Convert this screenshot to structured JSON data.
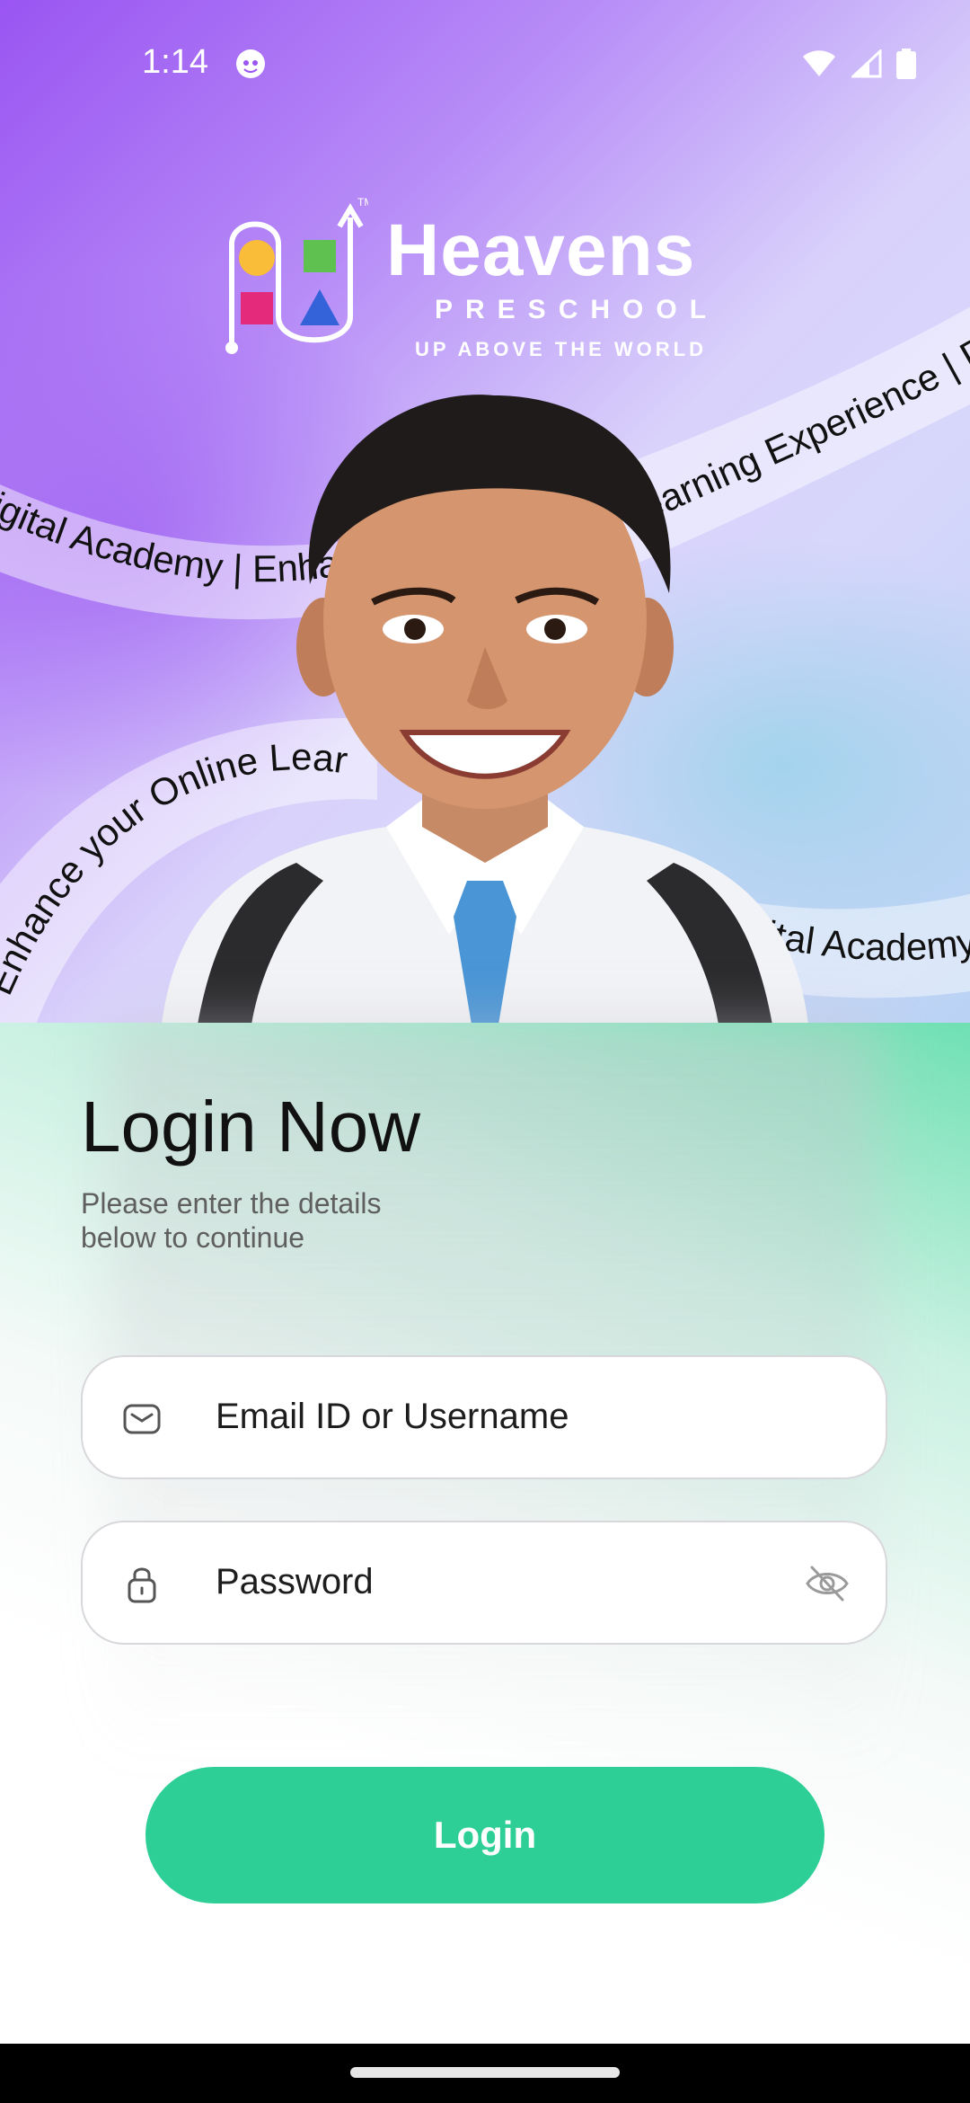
{
  "status_bar": {
    "time": "1:14"
  },
  "brand": {
    "name": "Heavens",
    "sub": "PRESCHOOL",
    "tagline": "UP ABOVE THE WORLD",
    "tm": "TM"
  },
  "ribbons": {
    "top_left": "Digital Academy | Enhance your Online Learning Experience | ",
    "top_right": "Learning Experience | Digital Academy",
    "middle_left": "Enhance your Online Learning Experience",
    "middle_right": "Digital Academy | Enhance"
  },
  "login": {
    "title": "Login Now",
    "subtitle": "Please enter the details below to continue",
    "email_placeholder": "Email ID or Username",
    "password_placeholder": "Password",
    "button_label": "Login"
  },
  "colors": {
    "accent": "#2ecf96",
    "hero_purple": "#9a55f2"
  },
  "icons": [
    "mail-icon",
    "lock-icon",
    "eye-off-icon",
    "wifi-icon",
    "signal-icon",
    "battery-icon"
  ]
}
